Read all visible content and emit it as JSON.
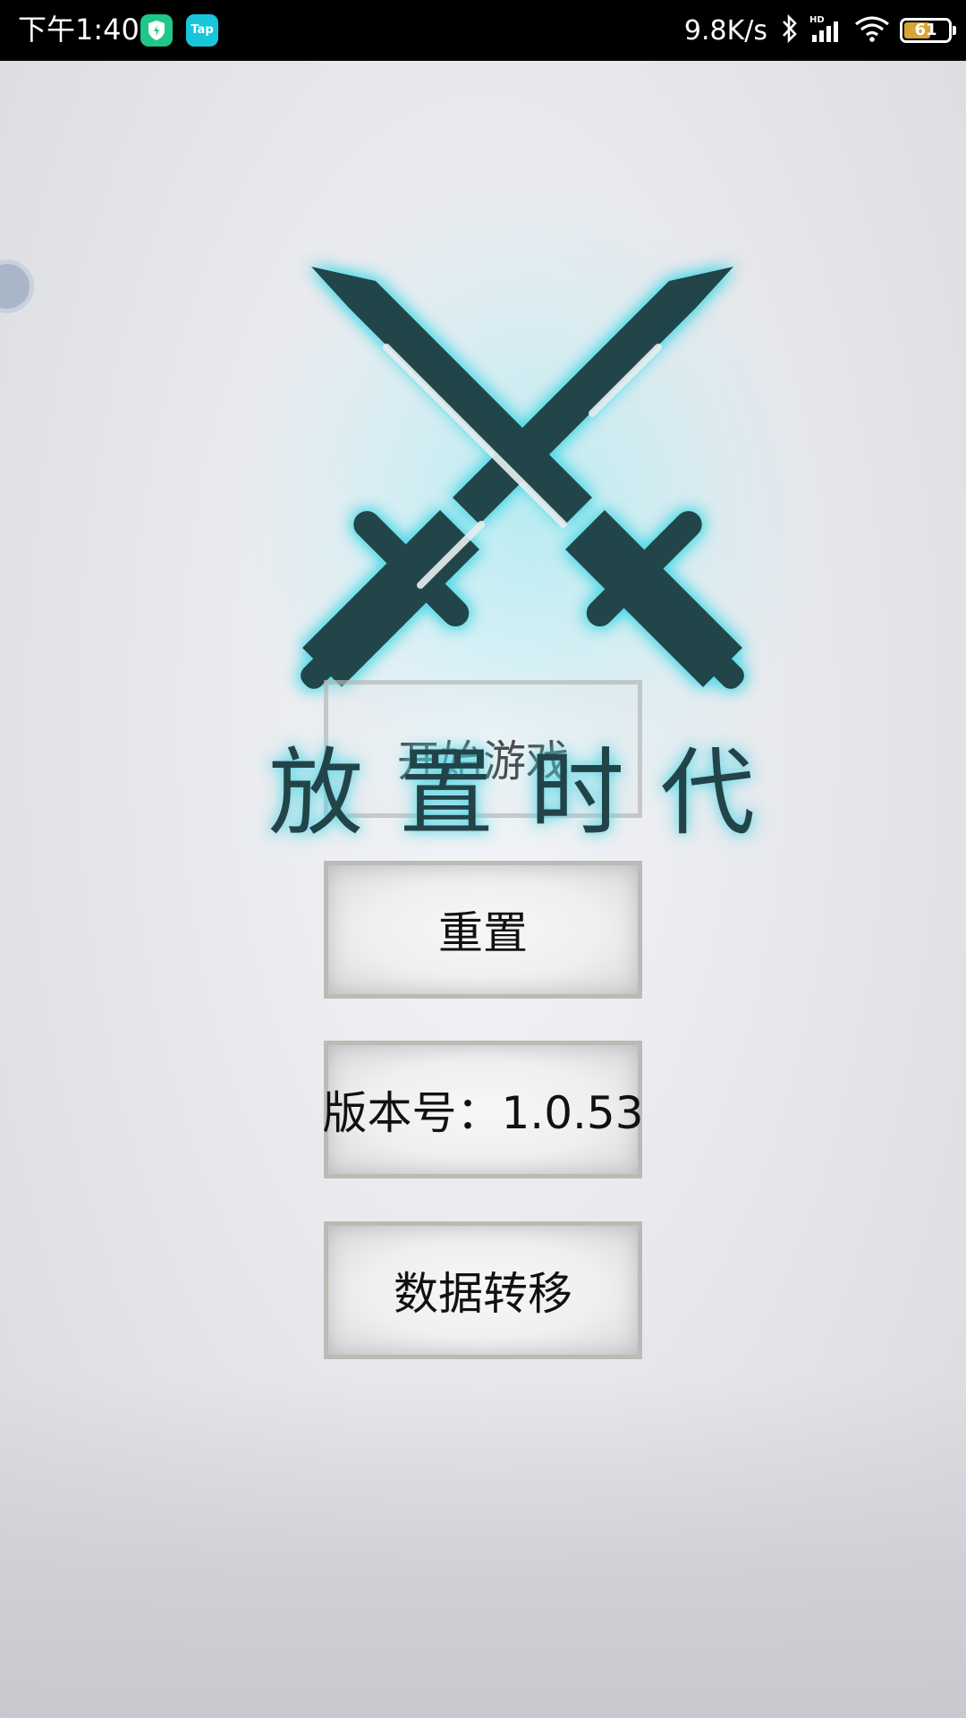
{
  "status_bar": {
    "time": "下午1:40",
    "tap_badge": "Tap",
    "net_speed": "9.8K/s",
    "battery_level": "61",
    "battery_fraction": 0.61,
    "icons": [
      "shield-app-icon",
      "tap-app-icon",
      "bluetooth-icon",
      "hd-signal-icon",
      "wifi-icon",
      "battery-icon"
    ]
  },
  "game": {
    "title": "放置时代",
    "logo_icon": "crossed-swords-icon",
    "glow_color": "#4fd8e6",
    "logo_color": "#224449"
  },
  "menu": {
    "start_label": "开始游戏",
    "reset_label": "重置",
    "version_label": "版本号：1.0.53",
    "transfer_label": "数据转移"
  }
}
